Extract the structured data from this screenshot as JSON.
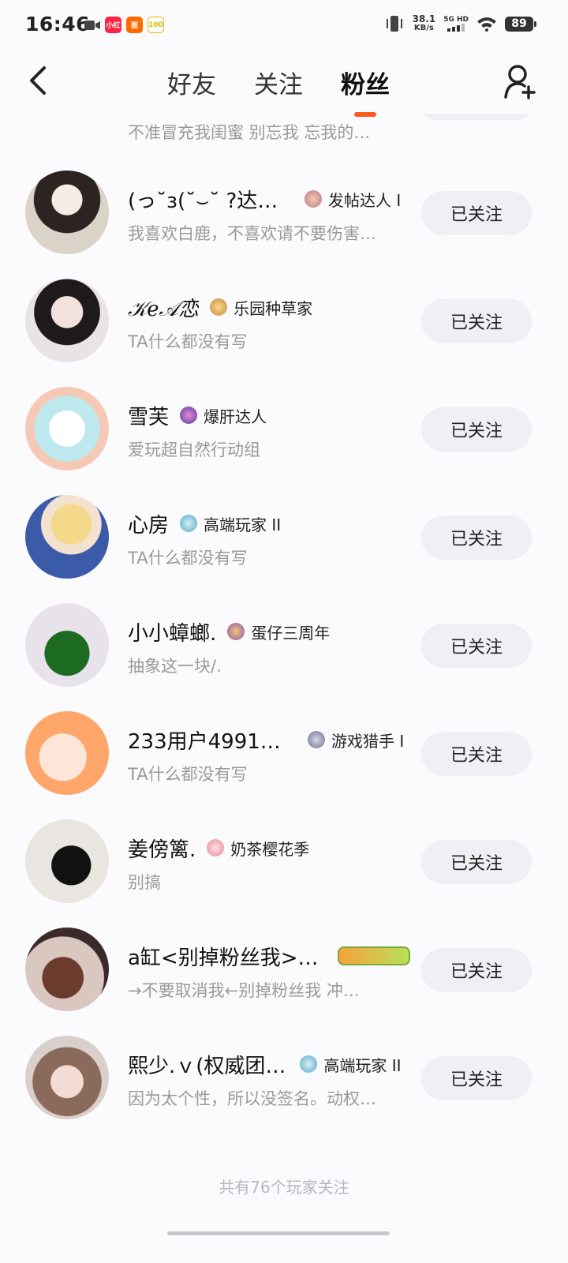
{
  "status_bar": {
    "time": "16:46",
    "net_speed_value": "38.1",
    "net_speed_unit": "KB/s",
    "net_type": "5G HD",
    "battery": "89"
  },
  "header": {
    "tabs": [
      "好友",
      "关注",
      "粉丝"
    ],
    "active_tab": "粉丝"
  },
  "partial_row": {
    "signature": "不准冒充我闺蜜 别忘我 忘我的…"
  },
  "followers": [
    {
      "name": "(っ˘з(˘⌣˘ ?达咩…",
      "badge": "发帖达人 I",
      "signature": "我喜欢白鹿，不喜欢请不要伤害…",
      "button": "已关注"
    },
    {
      "name": "𝒦𝑒𝒜恋",
      "badge": "乐园种草家",
      "signature": "TA什么都没有写",
      "button": "已关注"
    },
    {
      "name": "雪芙",
      "badge": "爆肝达人",
      "signature": "爱玩超自然行动组",
      "button": "已关注"
    },
    {
      "name": "心房",
      "badge": "高端玩家 II",
      "signature": "TA什么都没有写",
      "button": "已关注"
    },
    {
      "name": "小小蟑螂.",
      "badge": "蛋仔三周年",
      "signature": "抽象这一块/.",
      "button": "已关注"
    },
    {
      "name": "233用户49917…",
      "badge": "游戏猎手 I",
      "signature": "TA什么都没有写",
      "button": "已关注"
    },
    {
      "name": "姜傍篱.",
      "badge": "奶茶樱花季",
      "signature": "别搞",
      "button": "已关注"
    },
    {
      "name": "a缸<别掉粉丝我>…",
      "badge": "",
      "signature": "→不要取消我←别掉粉丝我 冲…",
      "button": "已关注"
    },
    {
      "name": "熙少.ｖ(权威团…",
      "badge": "高端玩家 II",
      "signature": "因为太个性，所以没签名。动权…",
      "button": "已关注"
    }
  ],
  "footer": {
    "text": "共有76个玩家关注"
  },
  "colors": {
    "accent": "#ff5a1f",
    "button_bg": "#f0eff3",
    "secondary_text": "#9a9a9a"
  }
}
